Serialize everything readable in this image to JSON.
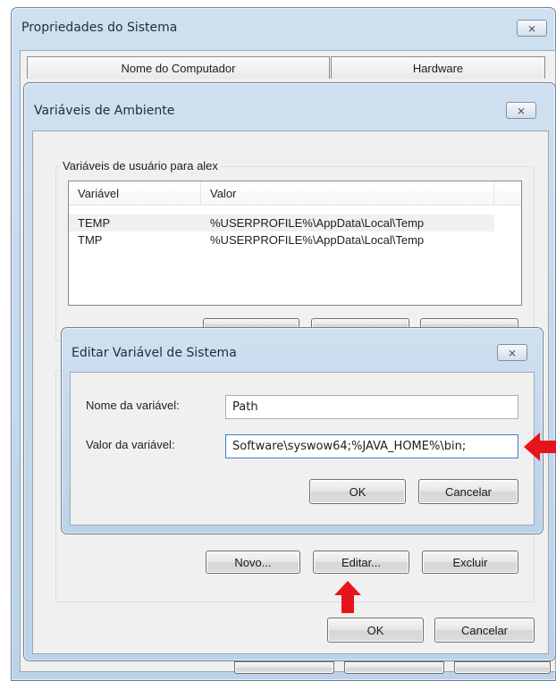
{
  "system_properties": {
    "title": "Propriedades do Sistema",
    "close_glyph": "⨯",
    "tabs": [
      "Nome do Computador",
      "Hardware"
    ]
  },
  "env_vars": {
    "title": "Variáveis de Ambiente",
    "close_glyph": "⨯",
    "user_group_label": "Variáveis de usuário para alex",
    "columns": [
      "Variável",
      "Valor"
    ],
    "rows": [
      {
        "name": "TEMP",
        "value": "%USERPROFILE%\\AppData\\Local\\Temp"
      },
      {
        "name": "TMP",
        "value": "%USERPROFILE%\\AppData\\Local\\Temp"
      }
    ],
    "buttons": {
      "new": "Novo...",
      "edit": "Editar...",
      "delete": "Excluir"
    },
    "ok": "OK",
    "cancel": "Cancelar"
  },
  "edit_system_var": {
    "title": "Editar Variável de Sistema",
    "close_glyph": "⨯",
    "name_label": "Nome da variável:",
    "name_value": "Path",
    "value_label": "Valor da variável:",
    "value_value": "Software\\syswow64;%JAVA_HOME%\\bin;",
    "ok": "OK",
    "cancel": "Cancelar"
  },
  "colors": {
    "highlight_arrow": "#e8141b",
    "frame_blue": "#bcd2e8"
  },
  "icons": {
    "close": "close-icon",
    "arrow_up": "red-arrow-up-icon",
    "arrow_left": "red-arrow-left-icon"
  }
}
